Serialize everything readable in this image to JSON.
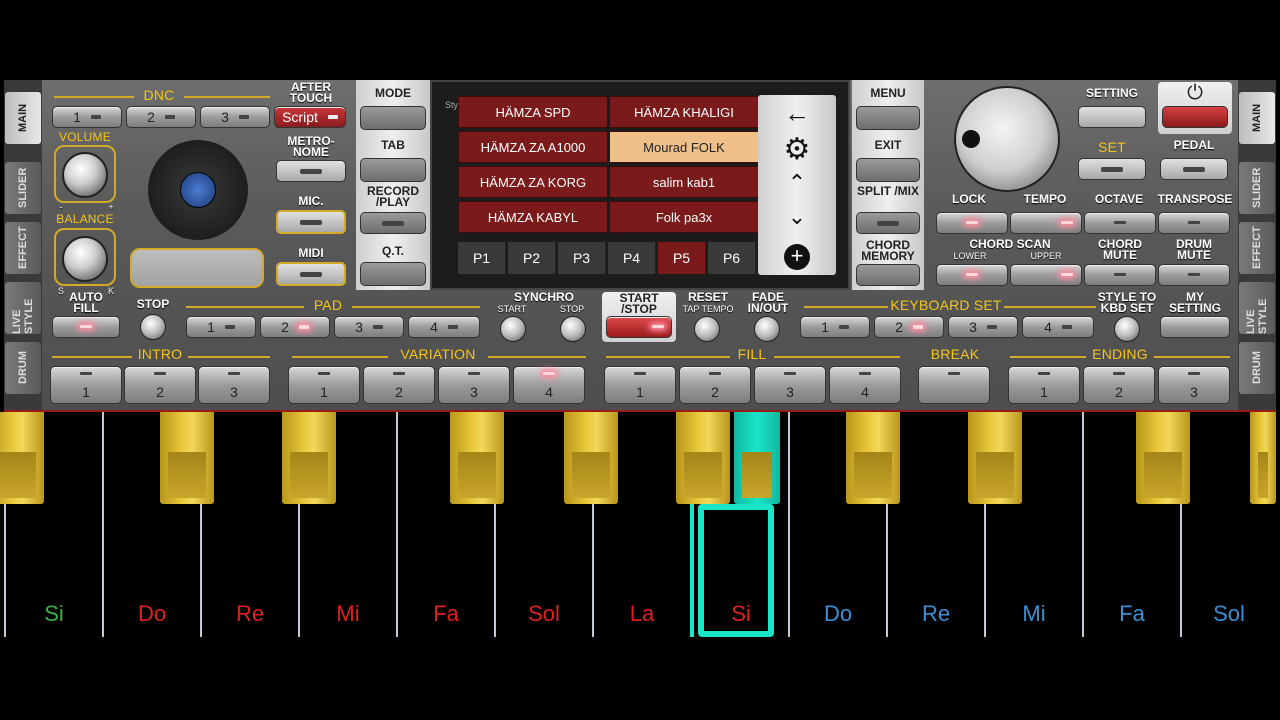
{
  "side_tabs_left": [
    "MAIN",
    "SLIDER",
    "EFFECT",
    "LIVE STYLE",
    "DRUM"
  ],
  "side_tabs_right": [
    "MAIN",
    "SLIDER",
    "EFFECT",
    "LIVE STYLE",
    "DRUM"
  ],
  "dnc": {
    "header": "DNC",
    "buttons": [
      "1",
      "2",
      "3"
    ]
  },
  "after_touch": {
    "label": "AFTER TOUCH",
    "value": "Script"
  },
  "volume": {
    "label": "VOLUME",
    "minus": "-",
    "plus": "+"
  },
  "balance": {
    "label": "BALANCE",
    "left": "S",
    "right": "K"
  },
  "metronome": {
    "label": "METRO-NOME"
  },
  "mic": {
    "label": "MIC."
  },
  "midi": {
    "label": "MIDI"
  },
  "auto_fill": {
    "label": "AUTO FILL"
  },
  "stop": {
    "label": "STOP"
  },
  "pad": {
    "header": "PAD",
    "buttons": [
      "1",
      "2",
      "3",
      "4"
    ]
  },
  "synchro": {
    "label": "SYNCHRO",
    "start": "START",
    "stop": "STOP"
  },
  "start_stop": {
    "label": "START /STOP"
  },
  "reset": {
    "label": "RESET",
    "sub": "TAP TEMPO"
  },
  "fade": {
    "label": "FADE IN/OUT"
  },
  "keyboard_set": {
    "header": "KEYBOARD SET",
    "buttons": [
      "1",
      "2",
      "3",
      "4"
    ]
  },
  "style_to_kbd": {
    "label": "STYLE TO KBD SET"
  },
  "my_setting": {
    "label": "MY SETTING"
  },
  "center_left_buttons": [
    "MODE",
    "TAB",
    "RECORD /PLAY",
    "Q.T."
  ],
  "style_vertical_label": "Style",
  "style_list": {
    "left": [
      "HÄMZA SPD",
      "HÄMZA ZA A1000",
      "HÄMZA ZA KORG",
      "HÄMZA KABYL"
    ],
    "right": [
      "HÄMZA KHALIGI",
      "Mourad FOLK",
      "salim kab1",
      "Folk pa3x"
    ],
    "selected": "Mourad FOLK"
  },
  "pages": [
    "P1",
    "P2",
    "P3",
    "P4",
    "P5",
    "P6"
  ],
  "selected_page": "P5",
  "nav_icons": [
    "back-arrow-icon",
    "gear-icon",
    "chevron-up-icon",
    "chevron-down-icon",
    "plus-circle-icon"
  ],
  "right_center_buttons": [
    "MENU",
    "EXIT",
    "SPLIT /MIX",
    "CHORD MEMORY"
  ],
  "setting": {
    "label": "SETTING"
  },
  "set": {
    "label": "SET"
  },
  "power": {
    "icon": "power-icon"
  },
  "pedal": {
    "label": "PEDAL"
  },
  "lock": {
    "label": "LOCK"
  },
  "tempo": {
    "label": "TEMPO"
  },
  "octave": {
    "label": "OCTAVE"
  },
  "transpose": {
    "label": "TRANSPOSE"
  },
  "chord_scan": {
    "label": "CHORD SCAN",
    "lower": "LOWER",
    "upper": "UPPER"
  },
  "chord_mute": {
    "label": "CHORD MUTE"
  },
  "drum_mute": {
    "label": "DRUM MUTE"
  },
  "intro": {
    "header": "INTRO",
    "buttons": [
      "1",
      "2",
      "3"
    ]
  },
  "variation": {
    "header": "VARIATION",
    "buttons": [
      "1",
      "2",
      "3",
      "4"
    ]
  },
  "fill": {
    "header": "FILL",
    "buttons": [
      "1",
      "2",
      "3",
      "4"
    ]
  },
  "break": {
    "header": "BREAK"
  },
  "ending": {
    "header": "ENDING",
    "buttons": [
      "1",
      "2",
      "3"
    ]
  },
  "keys": [
    {
      "name": "Si",
      "color": "#3cb043"
    },
    {
      "name": "Do",
      "color": "#e02020"
    },
    {
      "name": "Re",
      "color": "#e02020"
    },
    {
      "name": "Mi",
      "color": "#e02020"
    },
    {
      "name": "Fa",
      "color": "#e02020"
    },
    {
      "name": "Sol",
      "color": "#e02020"
    },
    {
      "name": "La",
      "color": "#e02020"
    },
    {
      "name": "Si",
      "color": "#e02020"
    },
    {
      "name": "Do",
      "color": "#3a8fd6"
    },
    {
      "name": "Re",
      "color": "#3a8fd6"
    },
    {
      "name": "Mi",
      "color": "#3a8fd6"
    },
    {
      "name": "Fa",
      "color": "#3a8fd6"
    },
    {
      "name": "Sol",
      "color": "#3a8fd6"
    }
  ],
  "pressed_key": "Si",
  "colors": {
    "accent": "#f5c518",
    "led": "#ff8aa0",
    "pressed": "#19e6c8",
    "style_cell": "#7a1a1a",
    "style_selected": "#f0c08a"
  }
}
